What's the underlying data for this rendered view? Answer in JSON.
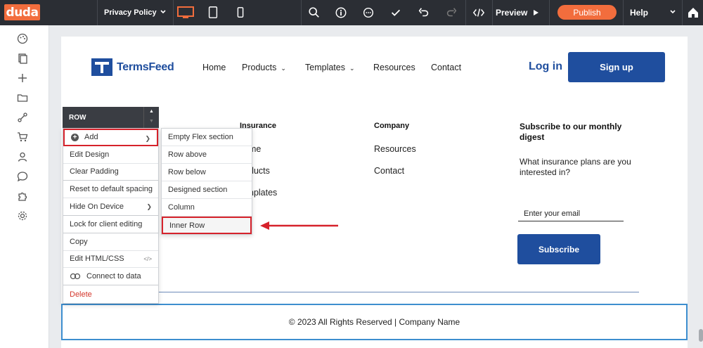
{
  "toolbar": {
    "logo": "duda",
    "page_name": "Privacy Policy",
    "preview_label": "Preview",
    "publish_label": "Publish",
    "help_label": "Help",
    "icons": [
      "desktop-icon",
      "tablet-icon",
      "mobile-icon",
      "search-icon",
      "info-icon",
      "comments-icon",
      "check-icon",
      "undo-icon",
      "redo-icon",
      "code-icon",
      "home-icon"
    ]
  },
  "sidebar": {
    "icons": [
      "palette-icon",
      "pages-icon",
      "add-icon",
      "folder-icon",
      "connections-icon",
      "cart-icon",
      "user-icon",
      "chat-icon",
      "puzzle-icon",
      "settings-icon"
    ]
  },
  "site": {
    "logo_text": "TermsFeed",
    "nav": [
      "Home",
      "Products",
      "Templates",
      "Resources",
      "Contact"
    ],
    "login": "Log in",
    "signup": "Sign up",
    "col_insurance_title": "Insurance",
    "col_insurance_links": [
      "me",
      "ducts",
      "nplates"
    ],
    "col_company_title": "Company",
    "col_company_links": [
      "Resources",
      "Contact"
    ],
    "subscribe_title": "Subscribe to our monthly digest",
    "subscribe_question": "What insurance plans are you interested in?",
    "email_placeholder": "Enter your email",
    "subscribe_button": "Subscribe",
    "footer_text": "© 2023 All Rights Reserved | Company Name"
  },
  "context_menu": {
    "header": "ROW",
    "items": [
      "Add",
      "Edit Design",
      "Clear Padding",
      "Reset to default spacing",
      "Hide On Device",
      "Lock for client editing",
      "Copy",
      "Edit HTML/CSS",
      "Connect to data",
      "Delete"
    ],
    "code_glyph": "</>"
  },
  "submenu": {
    "items": [
      "Empty Flex section",
      "Row above",
      "Row below",
      "Designed section",
      "Column",
      "Inner Row"
    ]
  },
  "colors": {
    "brand_orange": "#f26d3d",
    "site_blue": "#1f4e9e",
    "highlight_red": "#d6222b",
    "toolbar_dark": "#2b2e34"
  }
}
